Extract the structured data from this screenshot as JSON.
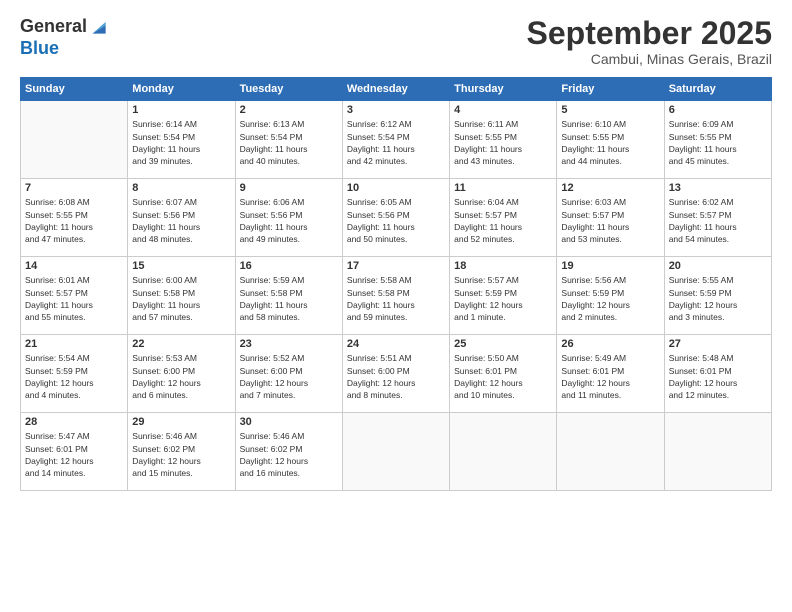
{
  "header": {
    "logo_line1": "General",
    "logo_line2": "Blue",
    "month_title": "September 2025",
    "location": "Cambui, Minas Gerais, Brazil"
  },
  "days_of_week": [
    "Sunday",
    "Monday",
    "Tuesday",
    "Wednesday",
    "Thursday",
    "Friday",
    "Saturday"
  ],
  "weeks": [
    [
      {
        "day": "",
        "info": ""
      },
      {
        "day": "1",
        "info": "Sunrise: 6:14 AM\nSunset: 5:54 PM\nDaylight: 11 hours\nand 39 minutes."
      },
      {
        "day": "2",
        "info": "Sunrise: 6:13 AM\nSunset: 5:54 PM\nDaylight: 11 hours\nand 40 minutes."
      },
      {
        "day": "3",
        "info": "Sunrise: 6:12 AM\nSunset: 5:54 PM\nDaylight: 11 hours\nand 42 minutes."
      },
      {
        "day": "4",
        "info": "Sunrise: 6:11 AM\nSunset: 5:55 PM\nDaylight: 11 hours\nand 43 minutes."
      },
      {
        "day": "5",
        "info": "Sunrise: 6:10 AM\nSunset: 5:55 PM\nDaylight: 11 hours\nand 44 minutes."
      },
      {
        "day": "6",
        "info": "Sunrise: 6:09 AM\nSunset: 5:55 PM\nDaylight: 11 hours\nand 45 minutes."
      }
    ],
    [
      {
        "day": "7",
        "info": "Sunrise: 6:08 AM\nSunset: 5:55 PM\nDaylight: 11 hours\nand 47 minutes."
      },
      {
        "day": "8",
        "info": "Sunrise: 6:07 AM\nSunset: 5:56 PM\nDaylight: 11 hours\nand 48 minutes."
      },
      {
        "day": "9",
        "info": "Sunrise: 6:06 AM\nSunset: 5:56 PM\nDaylight: 11 hours\nand 49 minutes."
      },
      {
        "day": "10",
        "info": "Sunrise: 6:05 AM\nSunset: 5:56 PM\nDaylight: 11 hours\nand 50 minutes."
      },
      {
        "day": "11",
        "info": "Sunrise: 6:04 AM\nSunset: 5:57 PM\nDaylight: 11 hours\nand 52 minutes."
      },
      {
        "day": "12",
        "info": "Sunrise: 6:03 AM\nSunset: 5:57 PM\nDaylight: 11 hours\nand 53 minutes."
      },
      {
        "day": "13",
        "info": "Sunrise: 6:02 AM\nSunset: 5:57 PM\nDaylight: 11 hours\nand 54 minutes."
      }
    ],
    [
      {
        "day": "14",
        "info": "Sunrise: 6:01 AM\nSunset: 5:57 PM\nDaylight: 11 hours\nand 55 minutes."
      },
      {
        "day": "15",
        "info": "Sunrise: 6:00 AM\nSunset: 5:58 PM\nDaylight: 11 hours\nand 57 minutes."
      },
      {
        "day": "16",
        "info": "Sunrise: 5:59 AM\nSunset: 5:58 PM\nDaylight: 11 hours\nand 58 minutes."
      },
      {
        "day": "17",
        "info": "Sunrise: 5:58 AM\nSunset: 5:58 PM\nDaylight: 11 hours\nand 59 minutes."
      },
      {
        "day": "18",
        "info": "Sunrise: 5:57 AM\nSunset: 5:59 PM\nDaylight: 12 hours\nand 1 minute."
      },
      {
        "day": "19",
        "info": "Sunrise: 5:56 AM\nSunset: 5:59 PM\nDaylight: 12 hours\nand 2 minutes."
      },
      {
        "day": "20",
        "info": "Sunrise: 5:55 AM\nSunset: 5:59 PM\nDaylight: 12 hours\nand 3 minutes."
      }
    ],
    [
      {
        "day": "21",
        "info": "Sunrise: 5:54 AM\nSunset: 5:59 PM\nDaylight: 12 hours\nand 4 minutes."
      },
      {
        "day": "22",
        "info": "Sunrise: 5:53 AM\nSunset: 6:00 PM\nDaylight: 12 hours\nand 6 minutes."
      },
      {
        "day": "23",
        "info": "Sunrise: 5:52 AM\nSunset: 6:00 PM\nDaylight: 12 hours\nand 7 minutes."
      },
      {
        "day": "24",
        "info": "Sunrise: 5:51 AM\nSunset: 6:00 PM\nDaylight: 12 hours\nand 8 minutes."
      },
      {
        "day": "25",
        "info": "Sunrise: 5:50 AM\nSunset: 6:01 PM\nDaylight: 12 hours\nand 10 minutes."
      },
      {
        "day": "26",
        "info": "Sunrise: 5:49 AM\nSunset: 6:01 PM\nDaylight: 12 hours\nand 11 minutes."
      },
      {
        "day": "27",
        "info": "Sunrise: 5:48 AM\nSunset: 6:01 PM\nDaylight: 12 hours\nand 12 minutes."
      }
    ],
    [
      {
        "day": "28",
        "info": "Sunrise: 5:47 AM\nSunset: 6:01 PM\nDaylight: 12 hours\nand 14 minutes."
      },
      {
        "day": "29",
        "info": "Sunrise: 5:46 AM\nSunset: 6:02 PM\nDaylight: 12 hours\nand 15 minutes."
      },
      {
        "day": "30",
        "info": "Sunrise: 5:46 AM\nSunset: 6:02 PM\nDaylight: 12 hours\nand 16 minutes."
      },
      {
        "day": "",
        "info": ""
      },
      {
        "day": "",
        "info": ""
      },
      {
        "day": "",
        "info": ""
      },
      {
        "day": "",
        "info": ""
      }
    ]
  ]
}
